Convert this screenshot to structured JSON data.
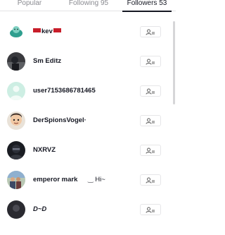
{
  "tabs": [
    {
      "label": "Popular"
    },
    {
      "label": "Following 95"
    },
    {
      "label": "Followers 53"
    }
  ],
  "accent_color": "#161823",
  "followers": [
    {
      "name": "kev",
      "extra": "",
      "avatar": "teal-character-avatar"
    },
    {
      "name": "Sm Editz",
      "extra": "",
      "avatar": "dark-photo-avatar"
    },
    {
      "name": "user7153686781465",
      "extra": "",
      "avatar": "default-person-avatar"
    },
    {
      "name": "DerSpionsVogel·",
      "extra": "",
      "avatar": "cartoon-face-avatar"
    },
    {
      "name": "NXRVZ",
      "extra": "",
      "avatar": "masked-figure-avatar"
    },
    {
      "name": "emperor mark",
      "extra": "‿ Hi~",
      "avatar": "group-photo-avatar"
    },
    {
      "name": "D~D",
      "extra": "",
      "avatar": "dark-photo-avatar"
    }
  ],
  "follow_button_icon": "add-user-icon"
}
